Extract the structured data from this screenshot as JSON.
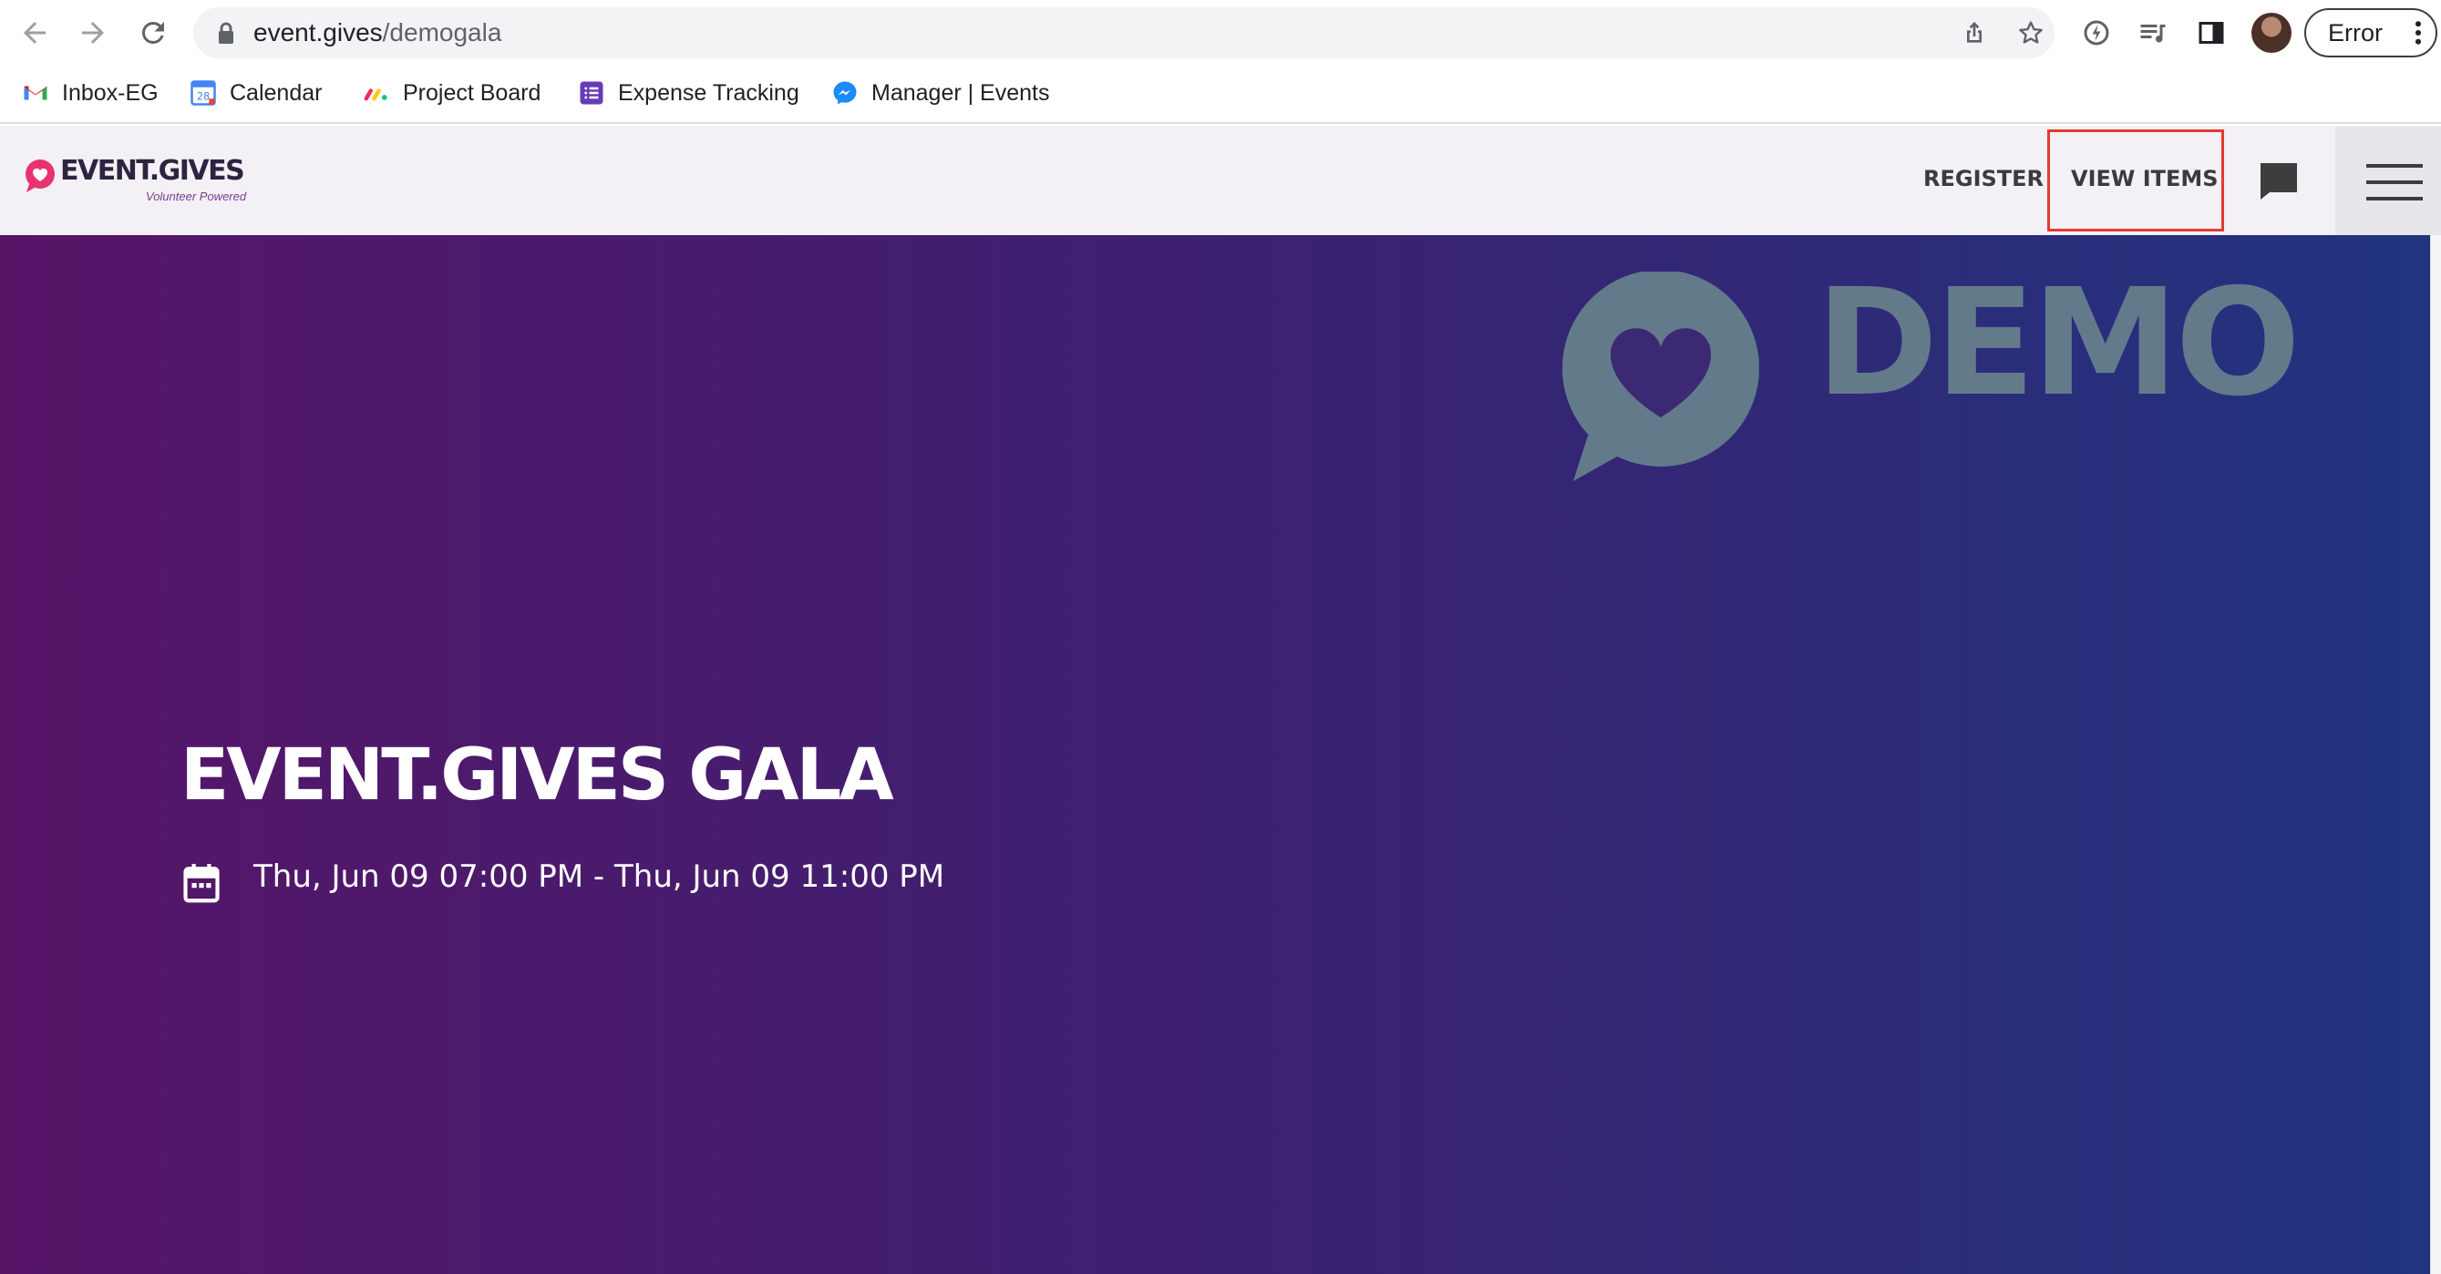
{
  "browser": {
    "url_domain": "event.gives",
    "url_path": "/demogala",
    "profile_error_label": "Error",
    "icons": {
      "back": "back-arrow-icon",
      "forward": "forward-arrow-icon",
      "reload": "reload-icon",
      "lock": "lock-icon",
      "share": "share-icon",
      "bookmark": "star-icon",
      "extension": "extension-icon",
      "media": "media-playlist-icon",
      "sidepanel": "side-panel-icon",
      "more": "more-vert-icon"
    }
  },
  "bookmarks": [
    {
      "label": "Inbox-EG",
      "icon": "gmail-icon"
    },
    {
      "label": "Calendar",
      "icon": "calendar-icon",
      "badge": "28"
    },
    {
      "label": "Project Board",
      "icon": "monday-icon"
    },
    {
      "label": "Expense Tracking",
      "icon": "list-icon"
    },
    {
      "label": "Manager | Events",
      "icon": "messenger-icon"
    }
  ],
  "site": {
    "logo_text": "EVENT.GIVES",
    "logo_tagline": "Volunteer Powered",
    "nav": {
      "register": "REGISTER",
      "view_items": "VIEW ITEMS"
    }
  },
  "hero": {
    "watermark": "DEMO",
    "title": "EVENT.GIVES GALA",
    "date_range": "Thu, Jun 09 07:00 PM - Thu, Jun 09 11:00 PM"
  },
  "colors": {
    "hero_gradient_start": "#571568",
    "hero_gradient_end": "#20347f",
    "watermark": "#637a8b",
    "logo_accent": "#e8336f",
    "highlight_box": "#e53a2f"
  }
}
